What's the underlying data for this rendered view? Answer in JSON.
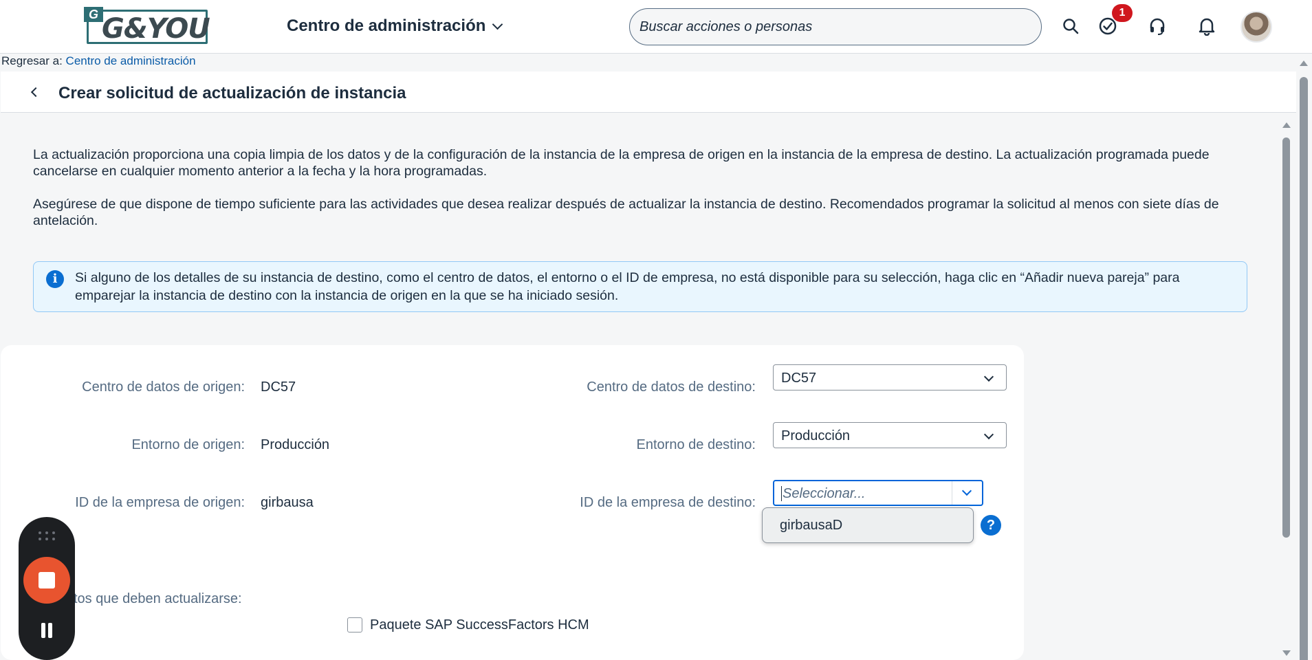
{
  "header": {
    "logo_text": "G&YOU",
    "logo_mark": "G",
    "app_title": "Centro de administración",
    "search_placeholder": "Buscar acciones o personas",
    "notification_count": "1",
    "icons": [
      "search-icon",
      "task-check-icon",
      "headset-icon",
      "bell-icon",
      "avatar"
    ]
  },
  "breadcrumb": {
    "prefix": "Regresar a: ",
    "link": "Centro de administración"
  },
  "page": {
    "title": "Crear solicitud de actualización de instancia",
    "paragraph1": "La actualización proporciona una copia limpia de los datos y de la configuración de la instancia de la empresa de origen en la instancia de la empresa de destino. La actualización programada puede cancelarse en cualquier momento anterior a la fecha y la hora programadas.",
    "paragraph2": "Asegúrese de que dispone de tiempo suficiente para las actividades que desea realizar después de actualizar la instancia de destino. Recomendados programar la solicitud al menos con siete días de antelación.",
    "info": "Si alguno de los detalles de su instancia de destino, como el centro de datos, el entorno o el ID de empresa, no está disponible para su selección, haga clic en “Añadir nueva pareja” para emparejar la instancia de destino con la instancia de origen en la que se ha iniciado sesión."
  },
  "form": {
    "source_dc_label": "Centro de datos de origen:",
    "source_dc_value": "DC57",
    "source_env_label": "Entorno de origen:",
    "source_env_value": "Producción",
    "source_id_label": "ID de la empresa de origen:",
    "source_id_value": "girbausa",
    "target_dc_label": "Centro de datos de destino:",
    "target_dc_value": "DC57",
    "target_env_label": "Entorno de destino:",
    "target_env_value": "Producción",
    "target_id_label": "ID de la empresa de destino:",
    "target_id_placeholder": "Seleccionar...",
    "target_id_suggestion": "girbausaD",
    "help_icon": "?"
  },
  "data_section": {
    "label": "tos que deben actualizarse:",
    "checkbox_label": "Paquete SAP SuccessFactors HCM",
    "checked": false
  },
  "colors": {
    "accent": "#0064d9",
    "info_bg": "#e9f6fe",
    "badge": "#d0171e",
    "record": "#e8542f"
  }
}
